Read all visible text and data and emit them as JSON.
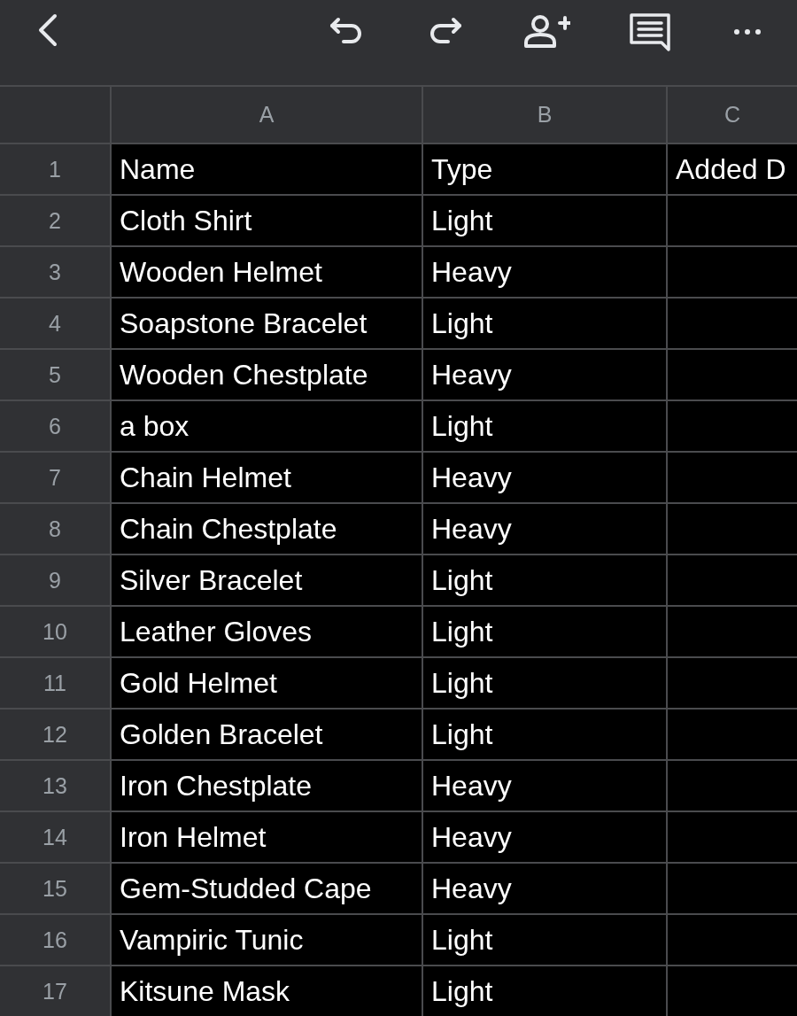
{
  "columns": [
    "A",
    "B",
    "C"
  ],
  "rows": [
    {
      "number": "1",
      "cells": [
        "Name",
        "Type",
        "Added D"
      ]
    },
    {
      "number": "2",
      "cells": [
        "Cloth Shirt",
        "Light"
      ]
    },
    {
      "number": "3",
      "cells": [
        "Wooden Helmet",
        "Heavy"
      ]
    },
    {
      "number": "4",
      "cells": [
        "Soapstone Bracelet",
        "Light"
      ]
    },
    {
      "number": "5",
      "cells": [
        "Wooden Chestplate",
        "Heavy"
      ]
    },
    {
      "number": "6",
      "cells": [
        "a box",
        "Light"
      ]
    },
    {
      "number": "7",
      "cells": [
        "Chain Helmet",
        "Heavy"
      ]
    },
    {
      "number": "8",
      "cells": [
        "Chain Chestplate",
        "Heavy"
      ]
    },
    {
      "number": "9",
      "cells": [
        "Silver Bracelet",
        "Light"
      ]
    },
    {
      "number": "10",
      "cells": [
        "Leather Gloves",
        "Light"
      ]
    },
    {
      "number": "11",
      "cells": [
        "Gold Helmet",
        "Light"
      ]
    },
    {
      "number": "12",
      "cells": [
        "Golden Bracelet",
        "Light"
      ]
    },
    {
      "number": "13",
      "cells": [
        "Iron Chestplate",
        "Heavy"
      ]
    },
    {
      "number": "14",
      "cells": [
        "Iron Helmet",
        "Heavy"
      ]
    },
    {
      "number": "15",
      "cells": [
        "Gem-Studded Cape",
        "Heavy"
      ]
    },
    {
      "number": "16",
      "cells": [
        "Vampiric Tunic",
        "Light"
      ]
    },
    {
      "number": "17",
      "cells": [
        "Kitsune Mask",
        "Light"
      ]
    }
  ]
}
